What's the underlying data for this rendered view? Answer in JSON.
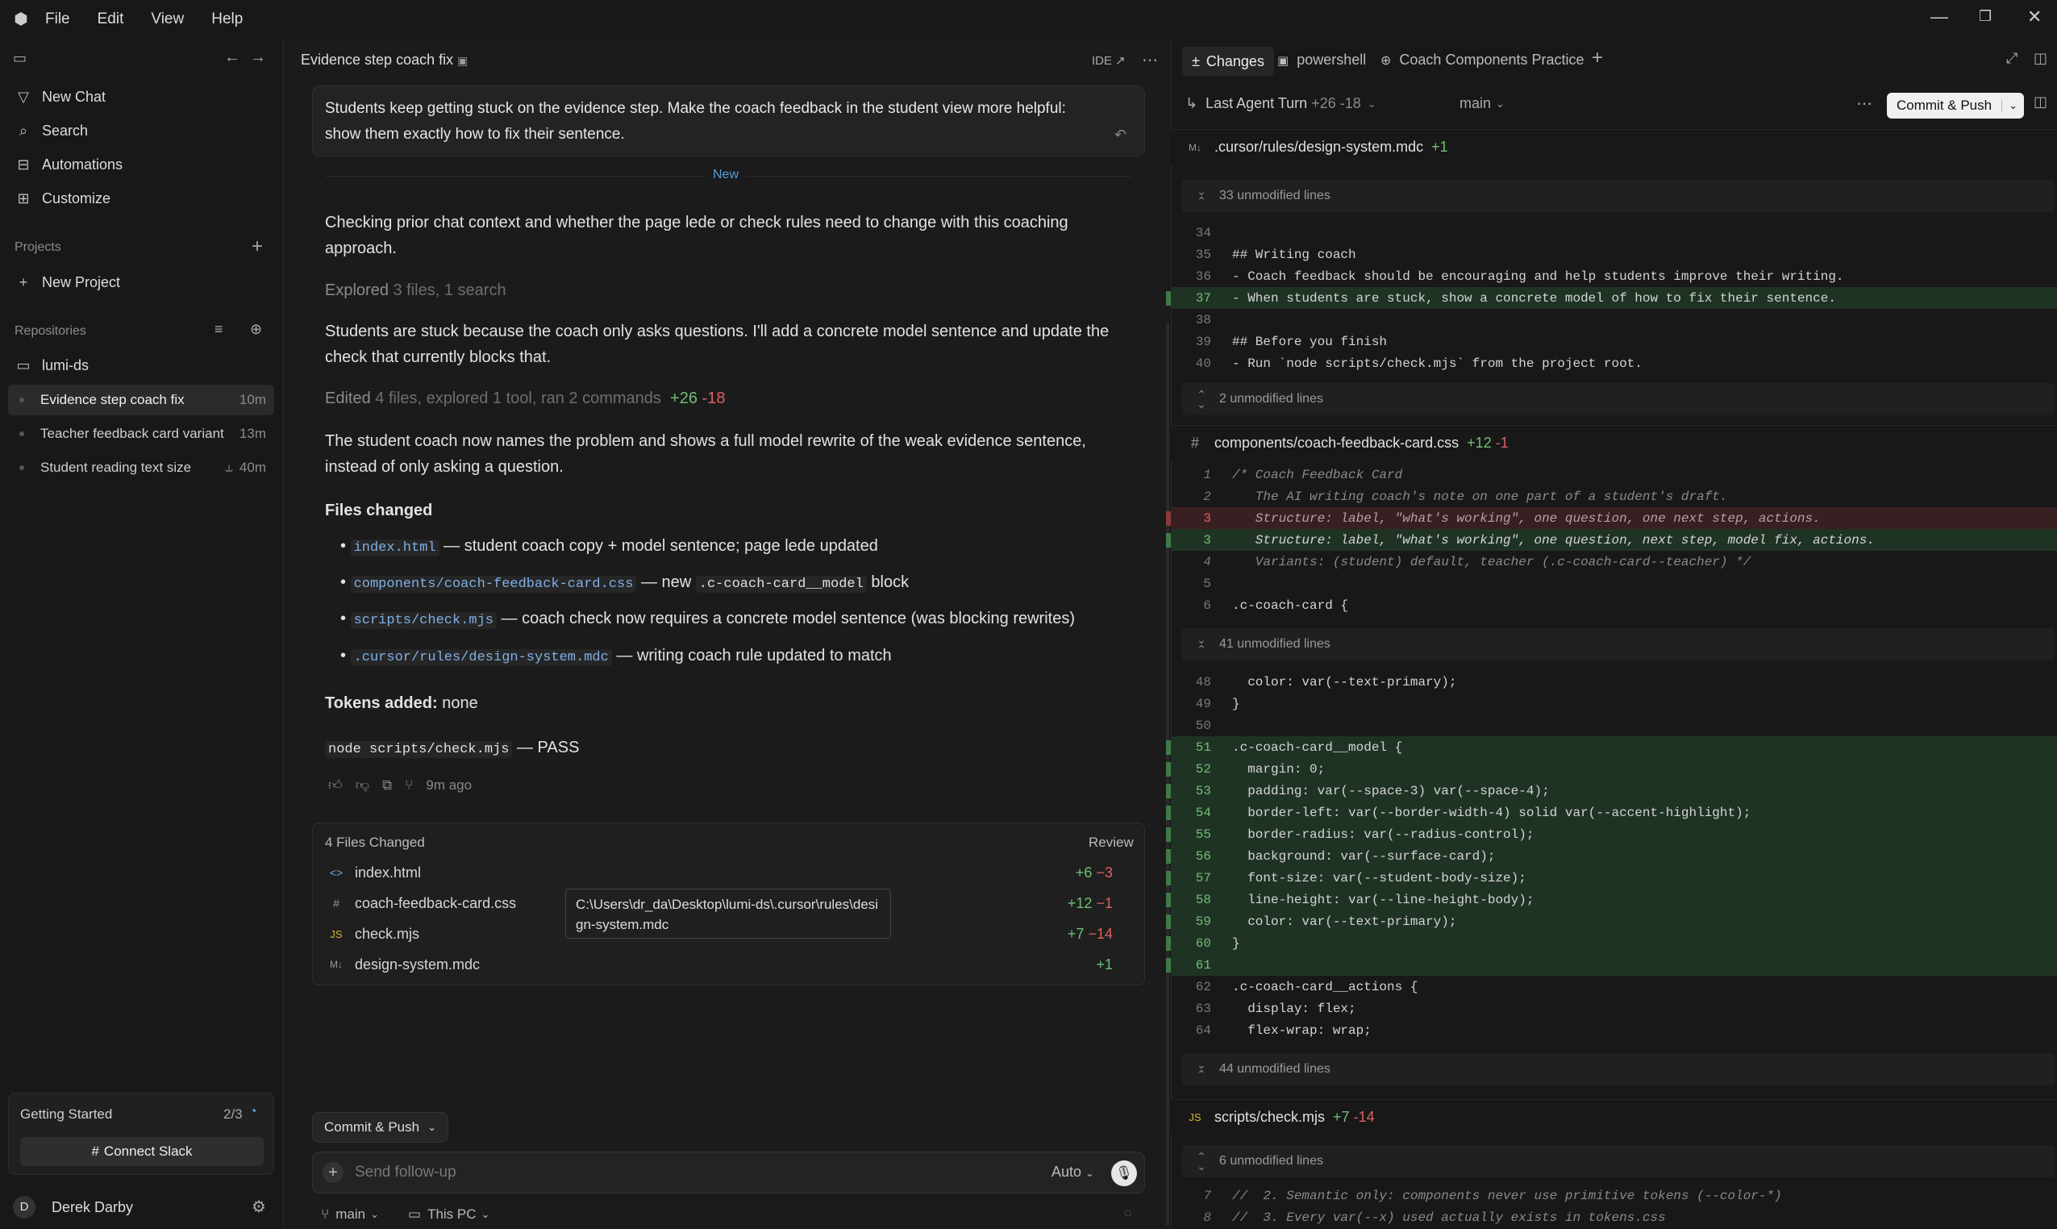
{
  "menubar": {
    "items": [
      "File",
      "Edit",
      "View",
      "Help"
    ]
  },
  "sidebar": {
    "new_chat": "New Chat",
    "search": "Search",
    "automations": "Automations",
    "customize": "Customize",
    "projects_label": "Projects",
    "new_project": "New Project",
    "repositories_label": "Repositories",
    "repo": "lumi-ds",
    "chats": [
      {
        "title": "Evidence step coach fix",
        "age": "10m"
      },
      {
        "title": "Teacher feedback card variant",
        "age": "13m"
      },
      {
        "title": "Student reading text size",
        "age": "40m"
      }
    ],
    "getting_started": "Getting Started",
    "getting_started_count": "2/3",
    "connect_slack": "Connect Slack",
    "user_initial": "D",
    "user_name": "Derek Darby"
  },
  "chat": {
    "title": "Evidence step coach fix",
    "ide_label": "IDE ↗",
    "user_msg": "Students keep getting stuck on the evidence step. Make the coach feedback in the student view more helpful: show them exactly how to fix their sentence.",
    "new_divider": "New",
    "p1": "Checking prior chat context and whether the page lede or check rules need to change with this coaching approach.",
    "explored_label": "Explored",
    "explored_detail": "3 files, 1 search",
    "p2": "Students are stuck because the coach only asks questions. I'll add a concrete model sentence and update the check that currently blocks that.",
    "edited_label": "Edited",
    "edited_detail": "4 files, explored 1 tool, ran 2 commands",
    "edited_add": "+26",
    "edited_del": "-18",
    "p3": "The student coach now names the problem and shows a full model rewrite of the weak evidence sentence, instead of only asking a question.",
    "files_changed_heading": "Files changed",
    "bullets": [
      {
        "code": "index.html",
        "text": " — student coach copy + model sentence; page lede updated"
      },
      {
        "code": "components/coach-feedback-card.css",
        "text": " — new ",
        "code2": ".c-coach-card__model",
        "text2": " block"
      },
      {
        "code": "scripts/check.mjs",
        "text": " — coach check now requires a concrete model sentence (was blocking rewrites)"
      },
      {
        "code": ".cursor/rules/design-system.mdc",
        "text": " — writing coach rule updated to match"
      }
    ],
    "tokens_label": "Tokens added:",
    "tokens_value": " none",
    "cmd": "node scripts/check.mjs",
    "cmd_result": " — PASS",
    "time_ago": "9m ago",
    "files_box": {
      "title": "4 Files Changed",
      "review": "Review",
      "files": [
        {
          "type": "<>",
          "name": "index.html",
          "add": "+6",
          "del": "−3"
        },
        {
          "type": "#",
          "name": "coach-feedback-card.css",
          "add": "+12",
          "del": "−1"
        },
        {
          "type": "JS",
          "name": "check.mjs",
          "add": "+7",
          "del": "−14"
        },
        {
          "type": "M↓",
          "name": "design-system.mdc",
          "add": "+1",
          "del": ""
        }
      ],
      "tooltip": "C:\\Users\\dr_da\\Desktop\\lumi-ds\\.cursor\\rules\\design-system.mdc"
    },
    "commit_push": "Commit & Push",
    "input_placeholder": "Send follow-up",
    "mode": "Auto",
    "branch": "main",
    "location": "This PC"
  },
  "diff": {
    "tabs": [
      "Changes",
      "powershell",
      "Coach Components Practice"
    ],
    "turn_label": "Last Agent Turn",
    "turn_add": "+26",
    "turn_del": "-18",
    "branch": "main",
    "commit_push": "Commit & Push",
    "file1": {
      "type": "M↓",
      "path": ".cursor/rules/design-system.mdc",
      "stat": "+1"
    },
    "unmod": [
      "33 unmodified lines",
      "2 unmodified lines",
      "41 unmodified lines",
      "44 unmodified lines",
      "6 unmodified lines"
    ],
    "file2": {
      "type": "#",
      "path": "components/coach-feedback-card.css",
      "add": "+12",
      "del": "-1"
    },
    "file3": {
      "type": "JS",
      "path": "scripts/check.mjs",
      "add": "+7",
      "del": "-14"
    },
    "f1_lines": [
      {
        "n": "34",
        "t": "",
        "k": ""
      },
      {
        "n": "35",
        "t": "## Writing coach",
        "k": ""
      },
      {
        "n": "36",
        "t": "- Coach feedback should be encouraging and help students improve their writing.",
        "k": ""
      },
      {
        "n": "37",
        "t": "- When students are stuck, show a concrete model of how to fix their sentence.",
        "k": "add"
      },
      {
        "n": "38",
        "t": "",
        "k": ""
      },
      {
        "n": "39",
        "t": "## Before you finish",
        "k": ""
      },
      {
        "n": "40",
        "t": "- Run `node scripts/check.mjs` from the project root.",
        "k": ""
      }
    ],
    "f2_lines_a": [
      {
        "n": "1",
        "t": "/* Coach Feedback Card",
        "k": "cmt"
      },
      {
        "n": "2",
        "t": "   The AI writing coach's note on one part of a student's draft.",
        "k": "cmt"
      },
      {
        "n": "3",
        "t": "   Structure: label, \"what's working\", one question, one next step, actions.",
        "k": "del"
      },
      {
        "n": "3",
        "t": "   Structure: label, \"what's working\", one question, next step, model fix, actions.",
        "k": "add"
      },
      {
        "n": "4",
        "t": "   Variants: (student) default, teacher (.c-coach-card--teacher) */",
        "k": "cmt"
      },
      {
        "n": "5",
        "t": "",
        "k": ""
      },
      {
        "n": "6",
        "t": ".c-coach-card {",
        "k": ""
      }
    ],
    "f2_lines_b": [
      {
        "n": "48",
        "t": "  color: var(--text-primary);",
        "k": ""
      },
      {
        "n": "49",
        "t": "}",
        "k": ""
      },
      {
        "n": "50",
        "t": "",
        "k": ""
      },
      {
        "n": "51",
        "t": ".c-coach-card__model {",
        "k": "add"
      },
      {
        "n": "52",
        "t": "  margin: 0;",
        "k": "add"
      },
      {
        "n": "53",
        "t": "  padding: var(--space-3) var(--space-4);",
        "k": "add"
      },
      {
        "n": "54",
        "t": "  border-left: var(--border-width-4) solid var(--accent-highlight);",
        "k": "add"
      },
      {
        "n": "55",
        "t": "  border-radius: var(--radius-control);",
        "k": "add"
      },
      {
        "n": "56",
        "t": "  background: var(--surface-card);",
        "k": "add"
      },
      {
        "n": "57",
        "t": "  font-size: var(--student-body-size);",
        "k": "add"
      },
      {
        "n": "58",
        "t": "  line-height: var(--line-height-body);",
        "k": "add"
      },
      {
        "n": "59",
        "t": "  color: var(--text-primary);",
        "k": "add"
      },
      {
        "n": "60",
        "t": "}",
        "k": "add"
      },
      {
        "n": "61",
        "t": "",
        "k": "add"
      },
      {
        "n": "62",
        "t": ".c-coach-card__actions {",
        "k": ""
      },
      {
        "n": "63",
        "t": "  display: flex;",
        "k": ""
      },
      {
        "n": "64",
        "t": "  flex-wrap: wrap;",
        "k": ""
      }
    ],
    "f3_lines": [
      {
        "n": "7",
        "t": "//  2. Semantic only: components never use primitive tokens (--color-*)",
        "k": "cmt"
      },
      {
        "n": "8",
        "t": "//  3. Every var(--x) used actually exists in tokens.css",
        "k": "cmt"
      }
    ]
  }
}
